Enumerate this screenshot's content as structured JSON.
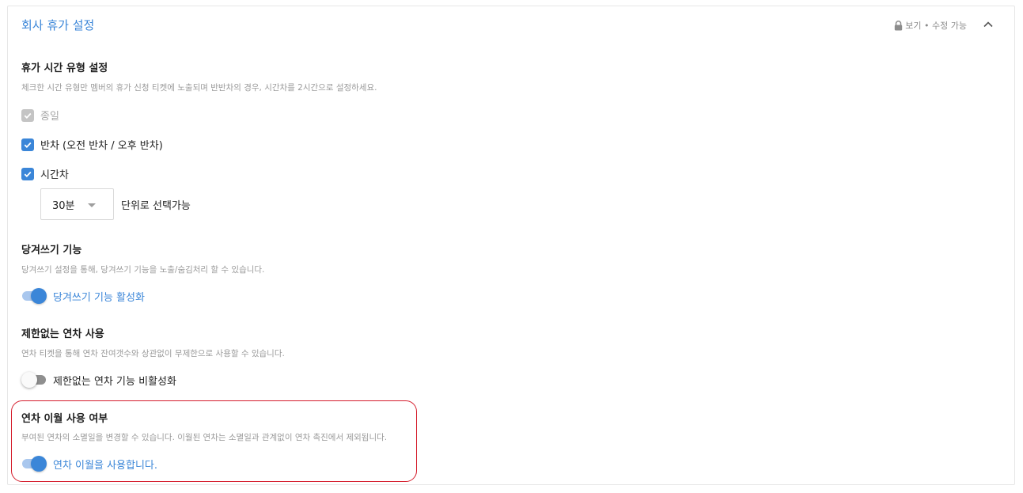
{
  "header": {
    "title": "회사 휴가 설정",
    "permission_label": "보기 • 수정 가능",
    "lock_icon": "lock-icon",
    "collapse_icon": "chevron-up-icon"
  },
  "time_types": {
    "title": "휴가 시간 유형 설정",
    "description": "체크한 시간 유형만 멤버의 휴가 신청 티켓에 노출되며 반반차의 경우, 시간차를 2시간으로 설정하세요.",
    "options": [
      {
        "label": "종일",
        "checked": true,
        "disabled": true
      },
      {
        "label": "반차 (오전 반차 / 오후 반차)",
        "checked": true,
        "disabled": false
      },
      {
        "label": "시간차",
        "checked": true,
        "disabled": false
      }
    ],
    "unit_select": {
      "value": "30분",
      "suffix": "단위로 선택가능"
    }
  },
  "pull_forward": {
    "title": "당겨쓰기 기능",
    "description": "당겨쓰기 설정을 통해, 당겨쓰기 기능을 노출/숨김처리 할 수 있습니다.",
    "toggle_label": "당겨쓰기 기능 활성화",
    "enabled": true
  },
  "unlimited": {
    "title": "제한없는 연차 사용",
    "description": "연차 티켓을 통해 연차 잔여갯수와 상관없이 무제한으로 사용할 수 있습니다.",
    "toggle_label": "제한없는 연차 기능 비활성화",
    "enabled": false
  },
  "carryover": {
    "title": "연차 이월 사용 여부",
    "description": "부여된 연차의 소멸일을 변경할 수 있습니다. 이월된 연차는 소멸일과 관계없이 연차 촉진에서 제외됩니다.",
    "toggle_label": "연차 이월을 사용합니다.",
    "enabled": true
  },
  "colors": {
    "accent": "#3b86d8",
    "highlight_border": "#d51d2c",
    "muted_text": "#9a9a9a"
  }
}
